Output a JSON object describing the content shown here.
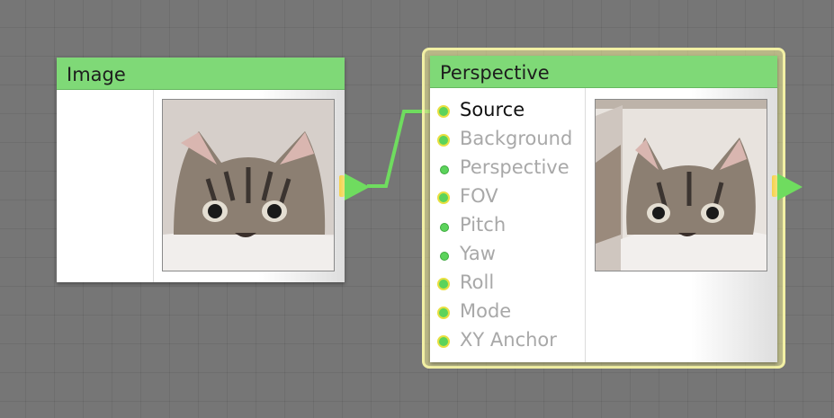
{
  "nodes": {
    "image": {
      "title": "Image"
    },
    "perspective": {
      "title": "Perspective",
      "inputs": [
        {
          "label": "Source",
          "connected": true,
          "ring": true
        },
        {
          "label": "Background",
          "connected": false,
          "ring": true
        },
        {
          "label": "Perspective",
          "connected": false,
          "ring": false
        },
        {
          "label": "FOV",
          "connected": false,
          "ring": true
        },
        {
          "label": "Pitch",
          "connected": false,
          "ring": false
        },
        {
          "label": "Yaw",
          "connected": false,
          "ring": false
        },
        {
          "label": "Roll",
          "connected": false,
          "ring": true
        },
        {
          "label": "Mode",
          "connected": false,
          "ring": true
        },
        {
          "label": "XY Anchor",
          "connected": false,
          "ring": true
        }
      ]
    }
  },
  "colors": {
    "canvas": "#767676",
    "header": "#7fd977",
    "port": "#5bd35b",
    "port_ring": "#e8e040",
    "wire": "#6fdc5f",
    "selection": "#f2f0a4"
  },
  "icons": {
    "output": "arrow-right-icon",
    "input": "port-dot-icon"
  }
}
